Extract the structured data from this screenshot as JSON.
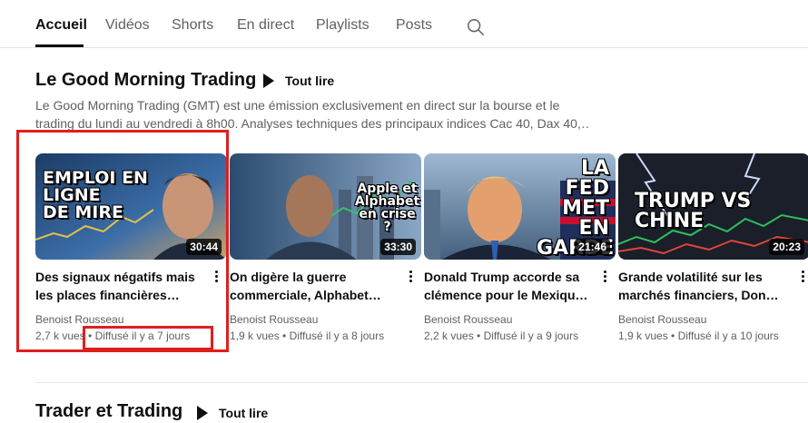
{
  "tabs": [
    "Accueil",
    "Vidéos",
    "Shorts",
    "En direct",
    "Playlists",
    "Posts"
  ],
  "active_tab": "Accueil",
  "section": {
    "title": "Le Good Morning Trading",
    "play_all": "Tout lire",
    "description_line1": "Le Good Morning Trading (GMT) est une émission exclusivement en direct sur la bourse et le",
    "description_line2": "trading du lundi au vendredi à 8h00. Analyses techniques des principaux indices Cac 40, Dax 40,…"
  },
  "videos": [
    {
      "thumb_text": [
        "EMPLOI EN",
        "LIGNE",
        "DE MIRE"
      ],
      "duration": "30:44",
      "title_line1": "Des signaux négatifs mais",
      "title_line2": "les places financières…",
      "channel": "Benoist Rousseau",
      "views": "2,7 k vues",
      "age": "Diffusé il y a 7 jours"
    },
    {
      "thumb_text": [
        "Apple et",
        "Alphabet",
        "en crise ?"
      ],
      "duration": "33:30",
      "title_line1": "On digère la guerre",
      "title_line2": "commerciale, Alphabet…",
      "channel": "Benoist Rousseau",
      "views": "1,9 k vues",
      "age": "Diffusé il y a 8 jours"
    },
    {
      "thumb_text": [
        "LA FED",
        "MET",
        "EN",
        "GARDE"
      ],
      "duration": "21:46",
      "title_line1": "Donald Trump accorde sa",
      "title_line2": "clémence pour le Mexique e…",
      "channel": "Benoist Rousseau",
      "views": "2,2 k vues",
      "age": "Diffusé il y a 9 jours"
    },
    {
      "thumb_text": [
        "TRUMP VS CHINE"
      ],
      "duration": "20:23",
      "title_line1": "Grande volatilité sur les",
      "title_line2": "marchés financiers, Donald…",
      "channel": "Benoist Rousseau",
      "views": "1,9 k vues",
      "age": "Diffusé il y a 10 jours"
    }
  ],
  "section2": {
    "title": "Trader et Trading",
    "play_all": "Tout lire"
  },
  "meta_separator": "•",
  "colors": {
    "highlight": "#e01e1e",
    "text_primary": "#0f0f0f",
    "text_secondary": "#606060"
  }
}
